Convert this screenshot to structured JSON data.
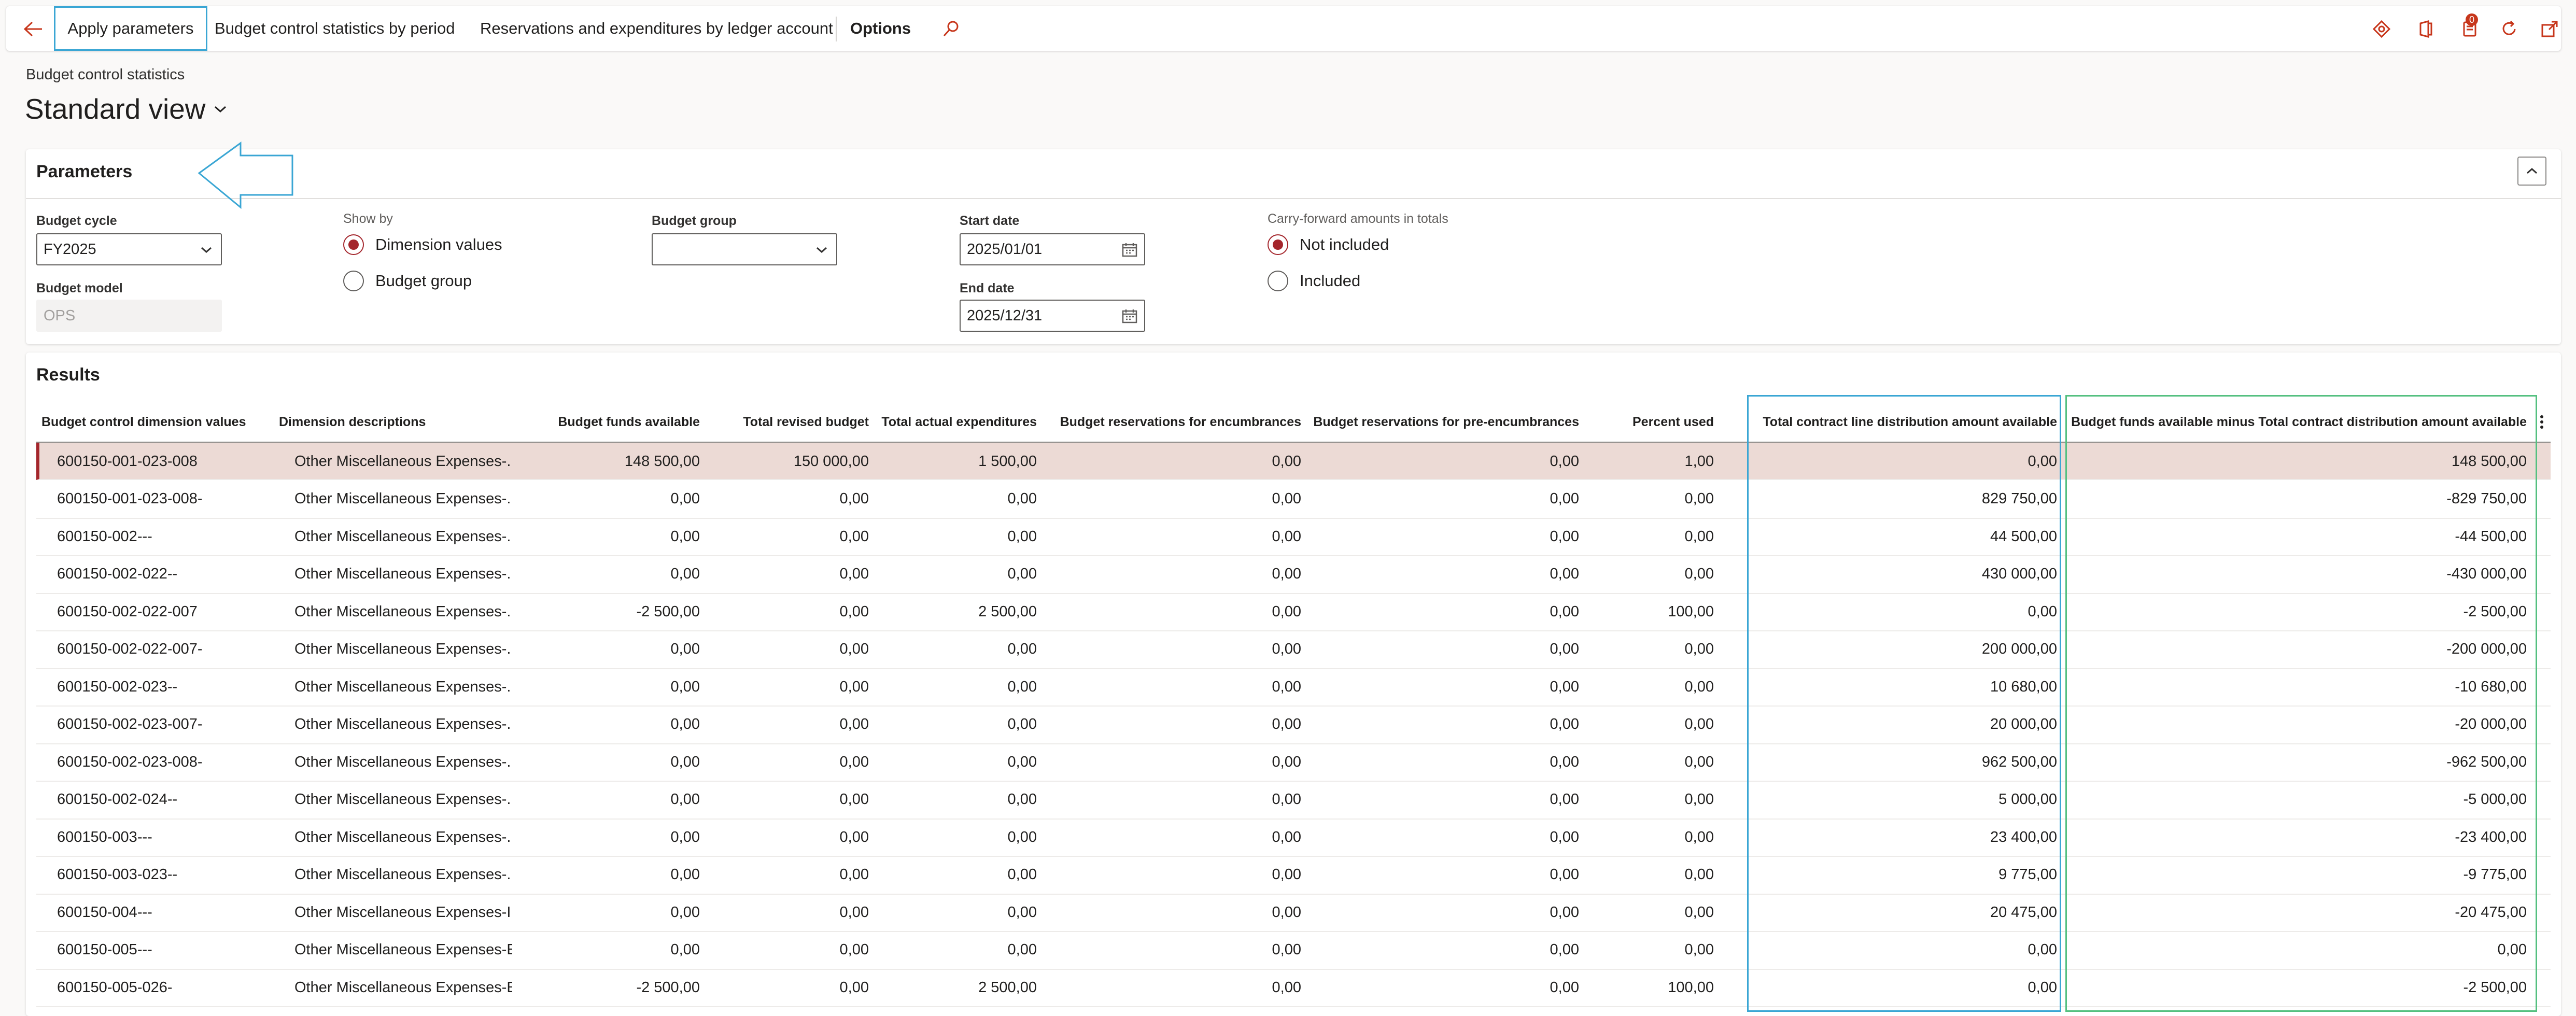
{
  "actionbar": {
    "apply_parameters": "Apply parameters",
    "stats_by_period": "Budget control statistics by period",
    "reservations_by_ledger": "Reservations and expenditures by ledger account",
    "options": "Options",
    "notification_count": "0"
  },
  "page": {
    "breadcrumb": "Budget control statistics",
    "view_title": "Standard view"
  },
  "parameters": {
    "title": "Parameters",
    "budget_cycle_label": "Budget cycle",
    "budget_cycle_value": "FY2025",
    "budget_model_label": "Budget model",
    "budget_model_value": "OPS",
    "show_by_label": "Show by",
    "show_by_options": [
      "Dimension values",
      "Budget group"
    ],
    "budget_group_label": "Budget group",
    "budget_group_value": "",
    "start_date_label": "Start date",
    "start_date_value": "2025/01/01",
    "end_date_label": "End date",
    "end_date_value": "2025/12/31",
    "carry_forward_label": "Carry-forward amounts in totals",
    "carry_forward_options": [
      "Not included",
      "Included"
    ]
  },
  "results": {
    "title": "Results",
    "columns": [
      "Budget control dimension values",
      "Dimension descriptions",
      "Budget funds available",
      "Total revised budget",
      "Total actual expenditures",
      "Budget reservations for encumbrances",
      "Budget reservations for pre-encumbrances",
      "Percent used",
      "Total contract line distribution amount available",
      "Budget funds available minus Total contract distribution amount available"
    ],
    "rows": [
      [
        "600150-001-023-008",
        "Other Miscellaneous Expenses-...",
        "148 500,00",
        "150 000,00",
        "1 500,00",
        "0,00",
        "0,00",
        "1,00",
        "0,00",
        "148 500,00"
      ],
      [
        "600150-001-023-008-",
        "Other Miscellaneous Expenses-...",
        "0,00",
        "0,00",
        "0,00",
        "0,00",
        "0,00",
        "0,00",
        "829 750,00",
        "-829 750,00"
      ],
      [
        "600150-002---",
        "Other Miscellaneous Expenses-...",
        "0,00",
        "0,00",
        "0,00",
        "0,00",
        "0,00",
        "0,00",
        "44 500,00",
        "-44 500,00"
      ],
      [
        "600150-002-022--",
        "Other Miscellaneous Expenses-...",
        "0,00",
        "0,00",
        "0,00",
        "0,00",
        "0,00",
        "0,00",
        "430 000,00",
        "-430 000,00"
      ],
      [
        "600150-002-022-007",
        "Other Miscellaneous Expenses-...",
        "-2 500,00",
        "0,00",
        "2 500,00",
        "0,00",
        "0,00",
        "100,00",
        "0,00",
        "-2 500,00"
      ],
      [
        "600150-002-022-007-",
        "Other Miscellaneous Expenses-...",
        "0,00",
        "0,00",
        "0,00",
        "0,00",
        "0,00",
        "0,00",
        "200 000,00",
        "-200 000,00"
      ],
      [
        "600150-002-023--",
        "Other Miscellaneous Expenses-...",
        "0,00",
        "0,00",
        "0,00",
        "0,00",
        "0,00",
        "0,00",
        "10 680,00",
        "-10 680,00"
      ],
      [
        "600150-002-023-007-",
        "Other Miscellaneous Expenses-...",
        "0,00",
        "0,00",
        "0,00",
        "0,00",
        "0,00",
        "0,00",
        "20 000,00",
        "-20 000,00"
      ],
      [
        "600150-002-023-008-",
        "Other Miscellaneous Expenses-...",
        "0,00",
        "0,00",
        "0,00",
        "0,00",
        "0,00",
        "0,00",
        "962 500,00",
        "-962 500,00"
      ],
      [
        "600150-002-024--",
        "Other Miscellaneous Expenses-...",
        "0,00",
        "0,00",
        "0,00",
        "0,00",
        "0,00",
        "0,00",
        "5 000,00",
        "-5 000,00"
      ],
      [
        "600150-003---",
        "Other Miscellaneous Expenses-...",
        "0,00",
        "0,00",
        "0,00",
        "0,00",
        "0,00",
        "0,00",
        "23 400,00",
        "-23 400,00"
      ],
      [
        "600150-003-023--",
        "Other Miscellaneous Expenses-...",
        "0,00",
        "0,00",
        "0,00",
        "0,00",
        "0,00",
        "0,00",
        "9 775,00",
        "-9 775,00"
      ],
      [
        "600150-004---",
        "Other Miscellaneous Expenses-I...",
        "0,00",
        "0,00",
        "0,00",
        "0,00",
        "0,00",
        "0,00",
        "20 475,00",
        "-20 475,00"
      ],
      [
        "600150-005---",
        "Other Miscellaneous Expenses-E...",
        "0,00",
        "0,00",
        "0,00",
        "0,00",
        "0,00",
        "0,00",
        "0,00",
        "0,00"
      ],
      [
        "600150-005-026-",
        "Other Miscellaneous Expenses-E...",
        "-2 500,00",
        "0,00",
        "2 500,00",
        "0,00",
        "0,00",
        "100,00",
        "0,00",
        "-2 500,00"
      ]
    ]
  },
  "colors": {
    "accent": "#a4262c",
    "selected_row": "#ecdad5",
    "highlight_blue": "#3aa6d4",
    "highlight_green": "#54c080"
  }
}
